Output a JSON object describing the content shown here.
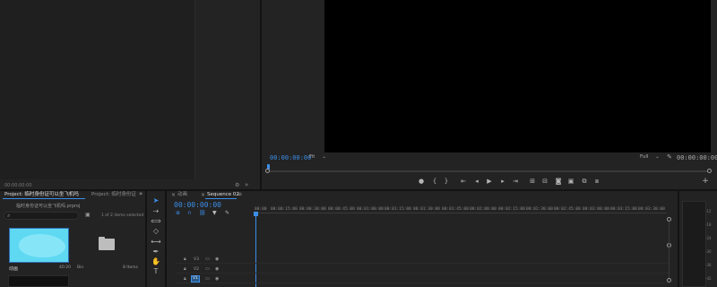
{
  "source_monitor": {
    "timecode": "00:00:00:00",
    "nav_icons": [
      "wrench-icon",
      "chevron-right-icon"
    ]
  },
  "program_monitor": {
    "timecode_current": "00:00:00:00",
    "fit_label": "Fit",
    "resolution_label": "Full",
    "timecode_duration": "00:00:00:00",
    "controls": [
      "marker-icon",
      "mark-in-icon",
      "mark-out-icon",
      "go-to-in-icon",
      "step-back-icon",
      "play-icon",
      "step-forward-icon",
      "go-to-out-icon",
      "insert-icon",
      "overwrite-icon",
      "export-frame-icon",
      "comparison-icon",
      "multicam-icon",
      "add-icon"
    ]
  },
  "project_panel": {
    "tab_active": "Project: 临时身份证可以坐飞机吗",
    "tab_inactive": "Project: 临时身份证",
    "file_name": "临时身份证可以坐飞机吗.prproj",
    "search_placeholder": "",
    "items_selected": "1 of 2 items selected",
    "items": [
      {
        "name": "动画",
        "duration": "40:20"
      },
      {
        "name": "Bin",
        "count": "8 Items"
      }
    ]
  },
  "timeline": {
    "tab_anim": "动画",
    "tab_sequence": "Sequence 02",
    "timecode": "00:00:00:00",
    "ruler": [
      "00:00",
      "00:00:15:00",
      "00:00:30:00",
      "00:00:45:00",
      "00:01:00:00",
      "00:01:15:00",
      "00:01:30:00",
      "00:01:45:00",
      "00:02:00:00",
      "00:02:15:00",
      "00:02:30:00",
      "00:02:45:00",
      "00:03:00:00",
      "00:03:15:00",
      "00:03:30:00"
    ],
    "tracks": [
      "V3",
      "V2",
      "V1"
    ]
  },
  "meters": {
    "labels": [
      "-12",
      "-18",
      "-24",
      "-30",
      "-36",
      "-42"
    ]
  },
  "colors": {
    "accent": "#3d8ee8",
    "panel": "#232323",
    "thumb": "#5fd8f2"
  }
}
